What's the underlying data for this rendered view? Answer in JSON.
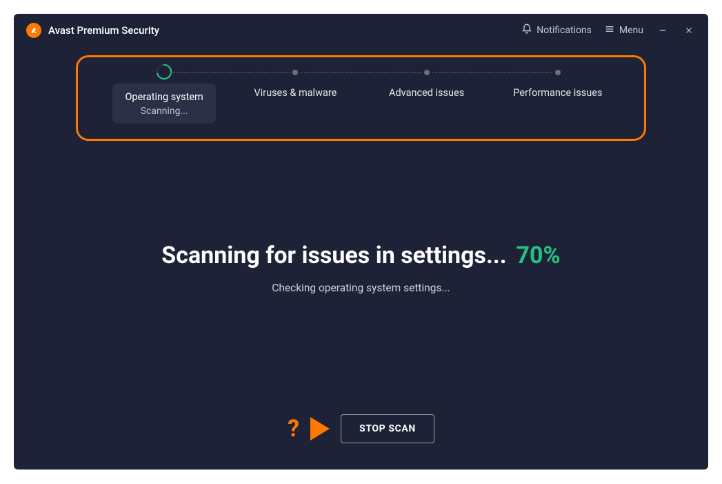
{
  "header": {
    "app_title": "Avast Premium Security",
    "notifications_label": "Notifications",
    "menu_label": "Menu"
  },
  "stepper": {
    "steps": [
      {
        "label": "Operating system",
        "sublabel": "Scanning...",
        "active": true
      },
      {
        "label": "Viruses & malware",
        "active": false
      },
      {
        "label": "Advanced issues",
        "active": false
      },
      {
        "label": "Performance issues",
        "active": false
      }
    ]
  },
  "scan": {
    "headline": "Scanning for issues in settings...",
    "percent": "70%",
    "subtext": "Checking operating system settings..."
  },
  "actions": {
    "help_marker": "?",
    "stop_label": "STOP SCAN"
  },
  "colors": {
    "accent_orange": "#ff7800",
    "accent_green": "#26c281",
    "bg": "#1d2236"
  }
}
